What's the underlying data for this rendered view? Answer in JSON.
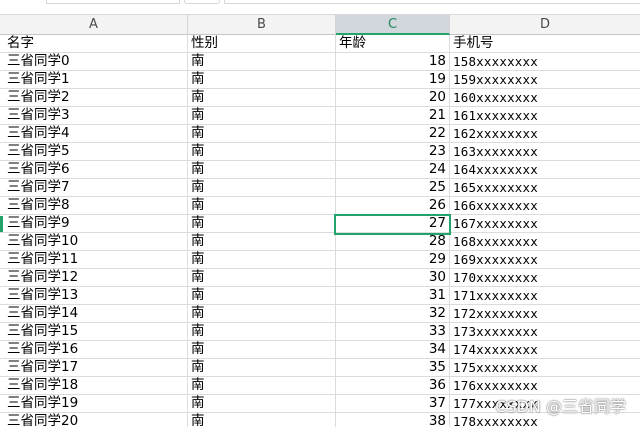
{
  "columns": [
    "A",
    "B",
    "C",
    "D"
  ],
  "active_column": "C",
  "header_row": {
    "name": "名字",
    "gender": "性别",
    "age": "年龄",
    "phone": "手机号"
  },
  "rows": [
    {
      "name": "三省同学0",
      "gender": "南",
      "age": "18",
      "phone": "158xxxxxxxx"
    },
    {
      "name": "三省同学1",
      "gender": "南",
      "age": "19",
      "phone": "159xxxxxxxx"
    },
    {
      "name": "三省同学2",
      "gender": "南",
      "age": "20",
      "phone": "160xxxxxxxx"
    },
    {
      "name": "三省同学3",
      "gender": "南",
      "age": "21",
      "phone": "161xxxxxxxx"
    },
    {
      "name": "三省同学4",
      "gender": "南",
      "age": "22",
      "phone": "162xxxxxxxx"
    },
    {
      "name": "三省同学5",
      "gender": "南",
      "age": "23",
      "phone": "163xxxxxxxx"
    },
    {
      "name": "三省同学6",
      "gender": "南",
      "age": "24",
      "phone": "164xxxxxxxx"
    },
    {
      "name": "三省同学7",
      "gender": "南",
      "age": "25",
      "phone": "165xxxxxxxx"
    },
    {
      "name": "三省同学8",
      "gender": "南",
      "age": "26",
      "phone": "166xxxxxxxx"
    },
    {
      "name": "三省同学9",
      "gender": "南",
      "age": "27",
      "phone": "167xxxxxxxx"
    },
    {
      "name": "三省同学10",
      "gender": "南",
      "age": "28",
      "phone": "168xxxxxxxx"
    },
    {
      "name": "三省同学11",
      "gender": "南",
      "age": "29",
      "phone": "169xxxxxxxx"
    },
    {
      "name": "三省同学12",
      "gender": "南",
      "age": "30",
      "phone": "170xxxxxxxx"
    },
    {
      "name": "三省同学13",
      "gender": "南",
      "age": "31",
      "phone": "171xxxxxxxx"
    },
    {
      "name": "三省同学14",
      "gender": "南",
      "age": "32",
      "phone": "172xxxxxxxx"
    },
    {
      "name": "三省同学15",
      "gender": "南",
      "age": "33",
      "phone": "173xxxxxxxx"
    },
    {
      "name": "三省同学16",
      "gender": "南",
      "age": "34",
      "phone": "174xxxxxxxx"
    },
    {
      "name": "三省同学17",
      "gender": "南",
      "age": "35",
      "phone": "175xxxxxxxx"
    },
    {
      "name": "三省同学18",
      "gender": "南",
      "age": "36",
      "phone": "176xxxxxxxx"
    },
    {
      "name": "三省同学19",
      "gender": "南",
      "age": "37",
      "phone": "177xxxxxxxx"
    },
    {
      "name": "三省同学20",
      "gender": "南",
      "age": "38",
      "phone": "178xxxxxxxx"
    }
  ],
  "selected_cell": {
    "column": "C",
    "value": "27"
  },
  "watermark": "CSDN @三省同学",
  "colors": {
    "accent": "#21a36b",
    "header_bg": "#f3f3f3",
    "active_header_bg": "#d2d6dd",
    "gridline": "#dcdcdc"
  }
}
